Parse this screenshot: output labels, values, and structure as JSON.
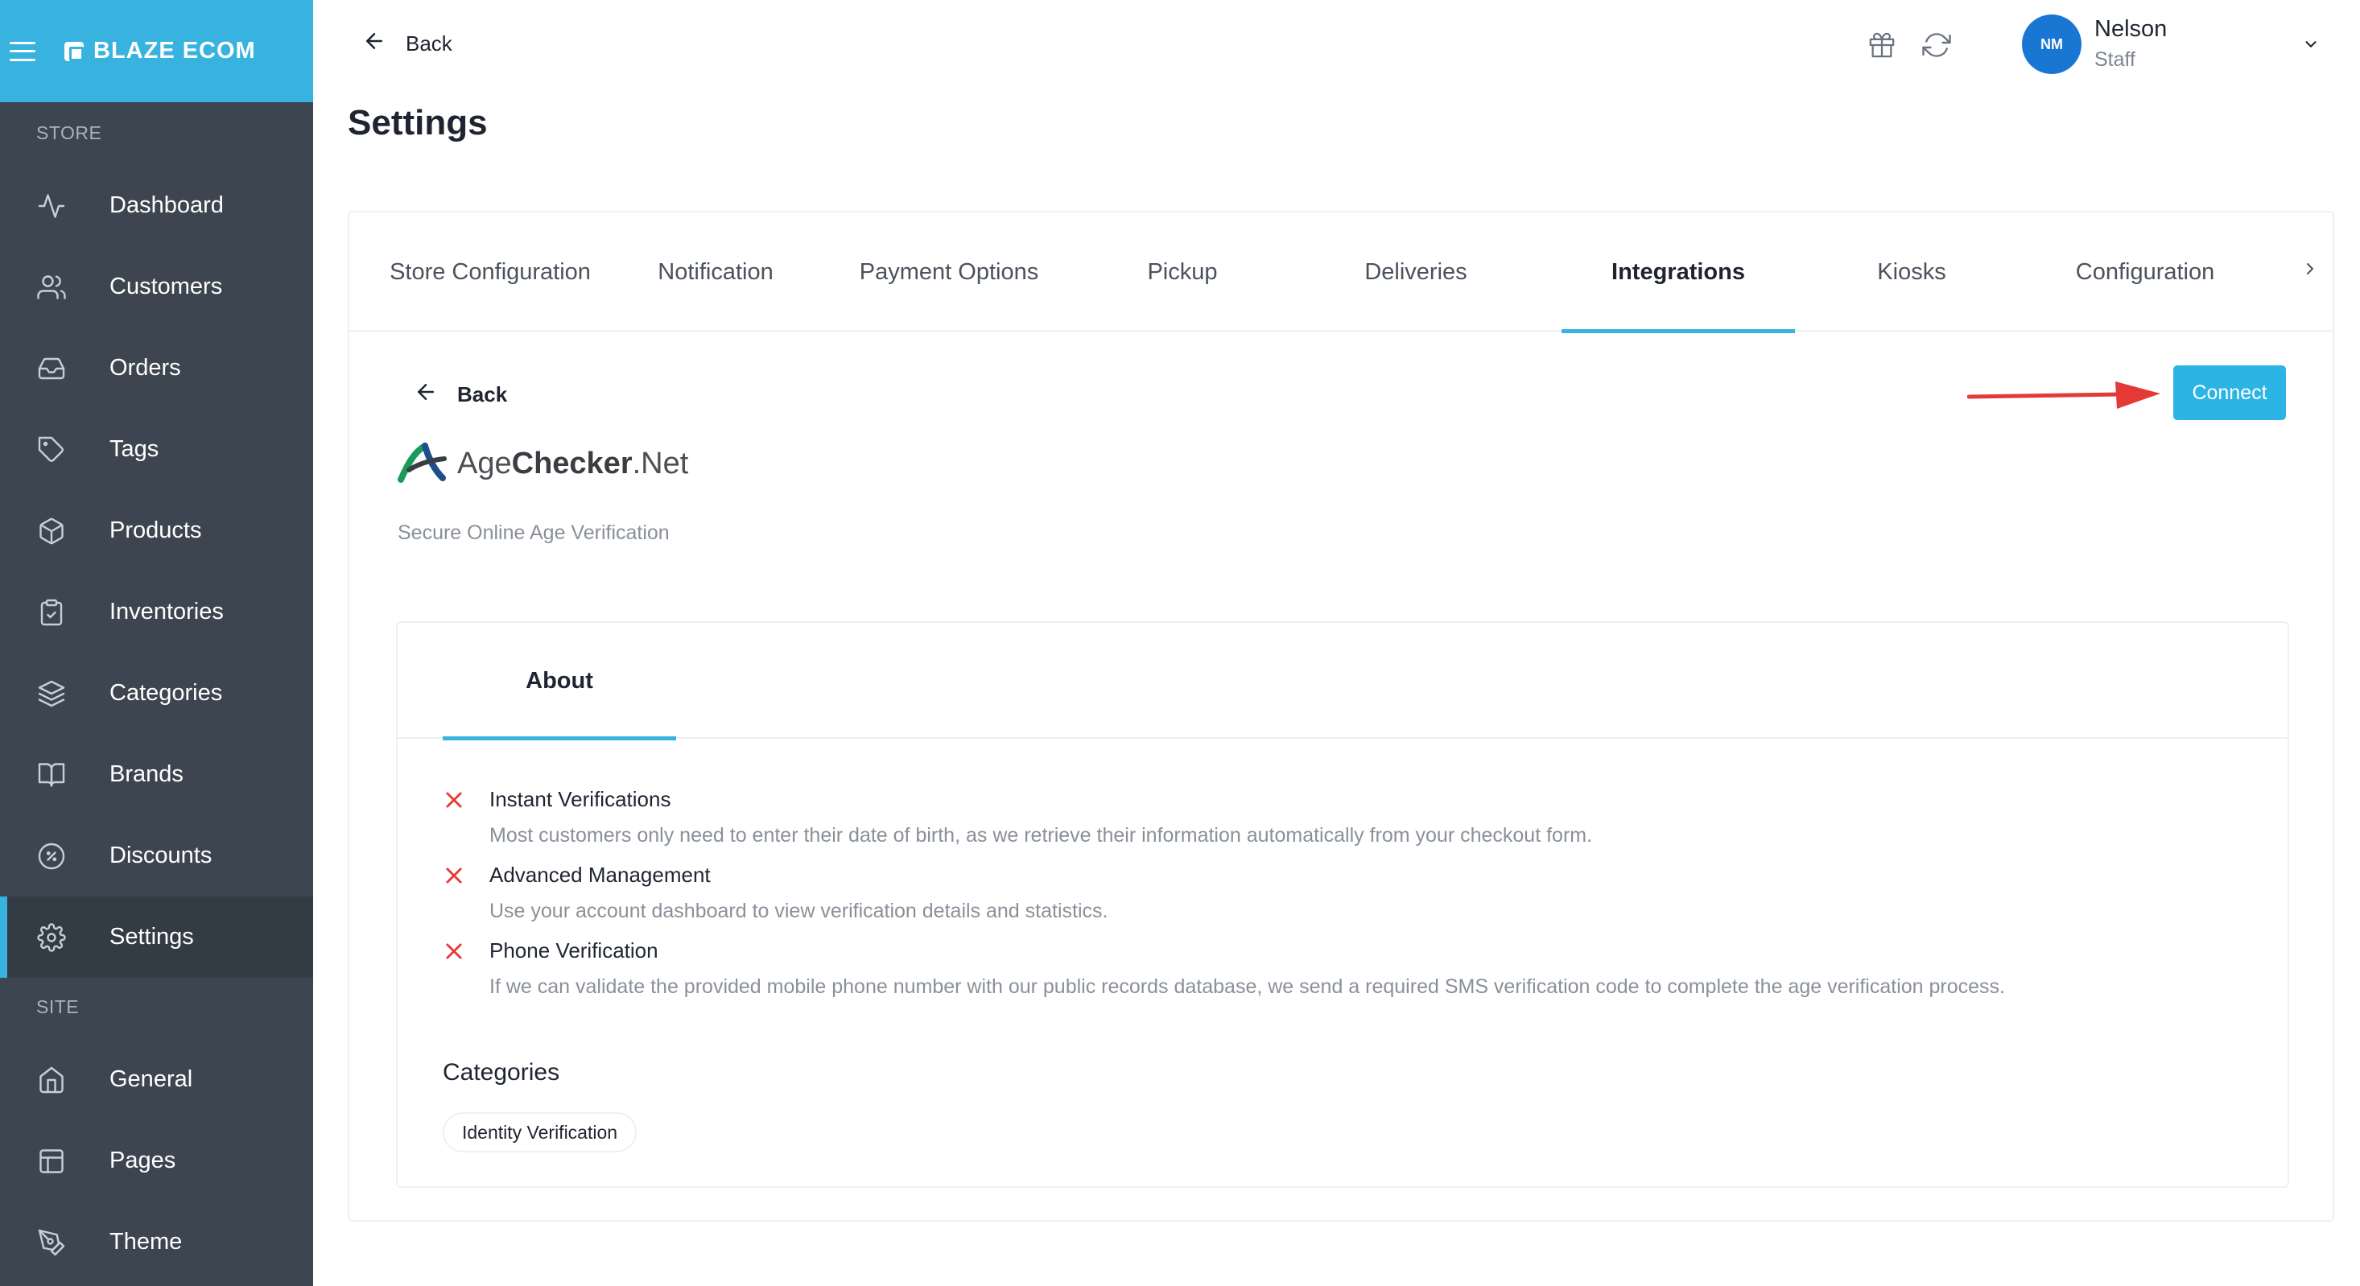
{
  "brand": {
    "name": "BLAZE ECOM"
  },
  "sidebar": {
    "store_label": "STORE",
    "site_label": "SITE",
    "store_items": [
      {
        "label": "Dashboard",
        "icon": "activity-icon"
      },
      {
        "label": "Customers",
        "icon": "users-icon"
      },
      {
        "label": "Orders",
        "icon": "inbox-icon"
      },
      {
        "label": "Tags",
        "icon": "tag-icon"
      },
      {
        "label": "Products",
        "icon": "box-icon"
      },
      {
        "label": "Inventories",
        "icon": "clipboard-check-icon"
      },
      {
        "label": "Categories",
        "icon": "layers-icon"
      },
      {
        "label": "Brands",
        "icon": "book-open-icon"
      },
      {
        "label": "Discounts",
        "icon": "percent-icon"
      },
      {
        "label": "Settings",
        "icon": "gear-icon",
        "active": true
      }
    ],
    "site_items": [
      {
        "label": "General",
        "icon": "home-icon"
      },
      {
        "label": "Pages",
        "icon": "layout-icon"
      },
      {
        "label": "Theme",
        "icon": "pen-tool-icon"
      }
    ]
  },
  "header": {
    "back_label": "Back",
    "page_title": "Settings",
    "user": {
      "initials": "NM",
      "name": "Nelson",
      "role": "Staff"
    }
  },
  "tabs": [
    {
      "label": "Store Configuration"
    },
    {
      "label": "Notification"
    },
    {
      "label": "Payment Options"
    },
    {
      "label": "Pickup"
    },
    {
      "label": "Deliveries"
    },
    {
      "label": "Integrations",
      "active": true
    },
    {
      "label": "Kiosks"
    },
    {
      "label": "Configuration"
    }
  ],
  "integration": {
    "back_label": "Back",
    "connect_label": "Connect",
    "logo_text_light": "Age",
    "logo_text_bold": "Checker",
    "logo_text_suffix": ".Net",
    "tagline": "Secure Online Age Verification",
    "about_tab": "About",
    "features": [
      {
        "title": "Instant Verifications",
        "description": "Most customers only need to enter their date of birth, as we retrieve their information automatically from your checkout form."
      },
      {
        "title": "Advanced Management",
        "description": "Use your account dashboard to view verification details and statistics."
      },
      {
        "title": "Phone Verification",
        "description": "If we can validate the provided mobile phone number with our public records database, we send a required SMS verification code to complete the age verification process."
      }
    ],
    "categories_heading": "Categories",
    "categories": [
      "Identity Verification"
    ]
  },
  "colors": {
    "sidebar_bg": "#3d4650",
    "accent": "#38b3e0",
    "connect_button": "#2cb5e4",
    "avatar": "#1976d2",
    "feature_x": "#e53935",
    "annotation_arrow": "#e53935"
  }
}
